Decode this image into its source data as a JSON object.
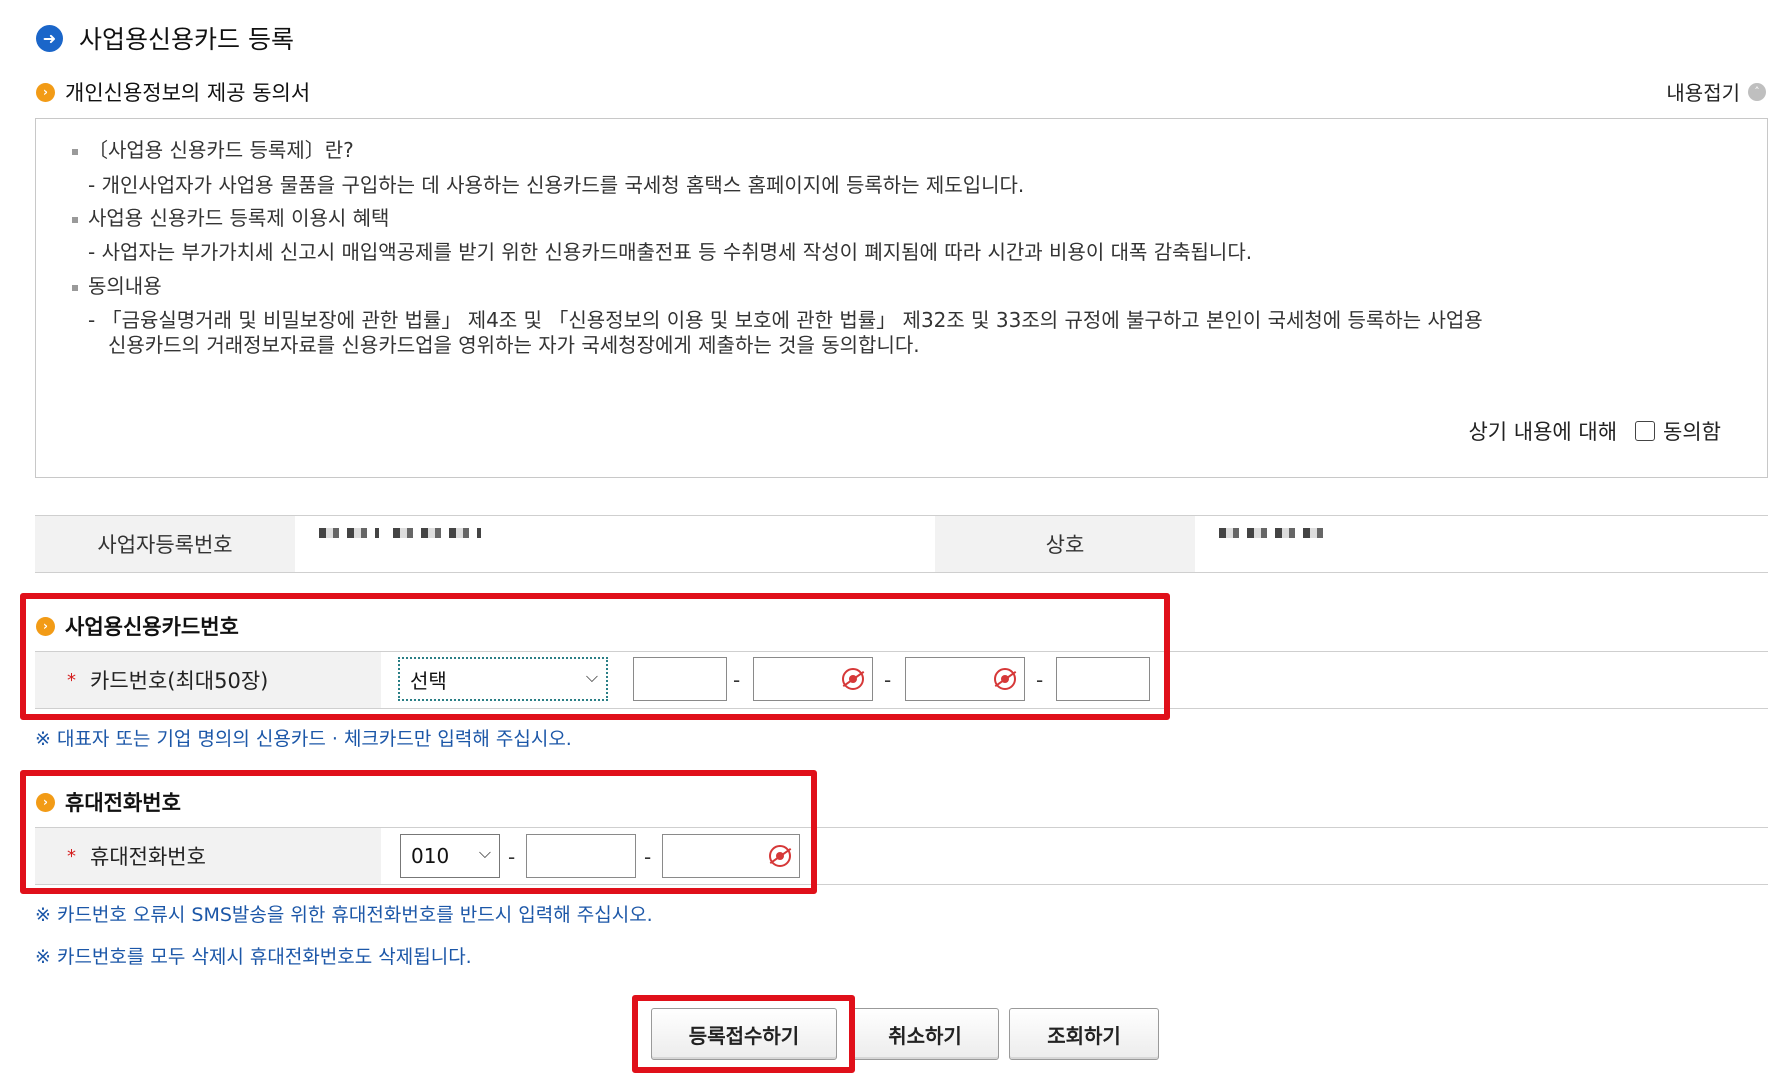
{
  "page": {
    "title": "사업용신용카드 등록"
  },
  "agreement": {
    "header": "개인신용정보의 제공 동의서",
    "collapse_label": "내용접기",
    "lines": [
      "〔사업용 신용카드 등록제〕란?",
      "- 개인사업자가 사업용 물품을 구입하는 데 사용하는 신용카드를 국세청 홈택스 홈페이지에 등록하는 제도입니다.",
      "사업용 신용카드 등록제 이용시 혜택",
      "- 사업자는 부가가치세 신고시 매입액공제를 받기 위한 신용카드매출전표 등 수취명세 작성이 폐지됨에 따라 시간과 비용이 대폭 감축됩니다.",
      "동의내용",
      "- 「금융실명거래 및 비밀보장에 관한 법률」 제4조 및 「신용정보의 이용 및 보호에 관한 법률」 제32조 및 33조의 규정에 불구하고 본인이 국세청에 등록하는 사업용",
      "신용카드의   거래정보자료를 신용카드업을 영위하는 자가 국세청장에게 제출하는 것을 동의합니다."
    ],
    "check_prefix": "상기 내용에 대해",
    "check_label": "동의함",
    "checked": false
  },
  "business_info": {
    "reg_number_label": "사업자등록번호",
    "company_label": "상호"
  },
  "card_section": {
    "header": "사업용신용카드번호",
    "field_label": "카드번호(최대50장)",
    "required_mark": "*",
    "card_select_value": "선택",
    "separator": "-",
    "notice": "※ 대표자 또는 기업 명의의 신용카드 · 체크카드만 입력해 주십시오."
  },
  "phone_section": {
    "header": "휴대전화번호",
    "field_label": "휴대전화번호",
    "required_mark": "*",
    "prefix_select_value": "010",
    "separator": "-",
    "notices": [
      "※ 카드번호 오류시 SMS발송을 위한 휴대전화번호를 반드시 입력해 주십시오.",
      "※ 카드번호를 모두 삭제시 휴대전화번호도 삭제됩니다."
    ]
  },
  "buttons": {
    "submit": "등록접수하기",
    "cancel": "취소하기",
    "inquire": "조회하기"
  },
  "colors": {
    "highlight": "#e0101a",
    "accent_blue": "#1b66c9",
    "section_orange": "#f29b16",
    "notice_blue": "#1c57a8"
  }
}
